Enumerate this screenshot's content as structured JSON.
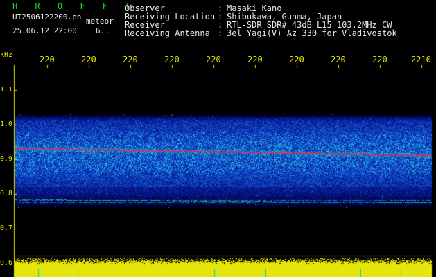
{
  "header": {
    "station": "H R O F F T",
    "file": "UT2506122200.pn",
    "kind": "meteor",
    "date": "25.06.12 22:00",
    "count": "6.."
  },
  "info": [
    {
      "label": "Observer",
      "value": "Masaki Kano"
    },
    {
      "label": "Receiving Location",
      "value": "Shibukawa, Gunma, Japan"
    },
    {
      "label": "Receiver",
      "value": "RTL-SDR SDR# 43dB L15 103.2MHz CW"
    },
    {
      "label": "Receiving Antenna",
      "value": "3el Yagi(V) Az 330 for Vladivostok"
    }
  ],
  "axis": {
    "y_unit": "kHz",
    "x_ticks": [
      "220",
      "220",
      "220",
      "220",
      "220",
      "220",
      "220",
      "220",
      "220",
      "2210"
    ],
    "y_ticks": [
      "1.1",
      "1.0",
      "0.9",
      "0.8",
      "0.7",
      "0.6"
    ]
  },
  "colors": {
    "header_green": "#18e018",
    "axis_yellow": "#e8e800",
    "signal_red": "#ff2a3a",
    "background_noise": "#0a1a8a"
  }
}
